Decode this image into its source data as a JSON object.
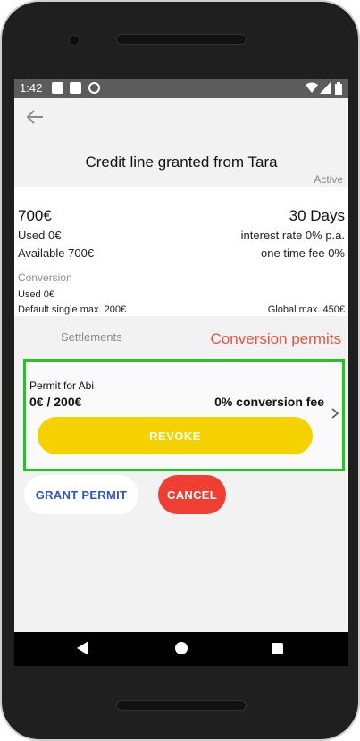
{
  "status_bar": {
    "time": "1:42"
  },
  "header": {
    "title": "Credit line granted from Tara",
    "status": "Active"
  },
  "summary": {
    "amount": "700€",
    "duration": "30 Days",
    "used": "Used 0€",
    "interest": "interest rate 0% p.a.",
    "available": "Available 700€",
    "fee": "one time fee 0%",
    "conversion_label": "Conversion",
    "conversion_used": "Used 0€",
    "default_single_max": "Default single max. 200€",
    "global_max": "Global max. 450€"
  },
  "tabs": {
    "settlements": "Settlements",
    "conversion_permits": "Conversion permits"
  },
  "permit": {
    "for": "Permit for Abi",
    "amount": "0€ / 200€",
    "fee": "0% conversion fee",
    "revoke_label": "REVOKE"
  },
  "actions": {
    "grant_label": "GRANT PERMIT",
    "cancel_label": "CANCEL"
  },
  "colors": {
    "accent_red": "#ee4f3c",
    "revoke_yellow": "#f5d100",
    "highlight_green": "#1ec71e",
    "grant_blue": "#2f54c8"
  },
  "icons": [
    "back-arrow-icon",
    "chevron-right-icon",
    "nav-back-icon",
    "nav-home-icon",
    "nav-recent-icon"
  ]
}
